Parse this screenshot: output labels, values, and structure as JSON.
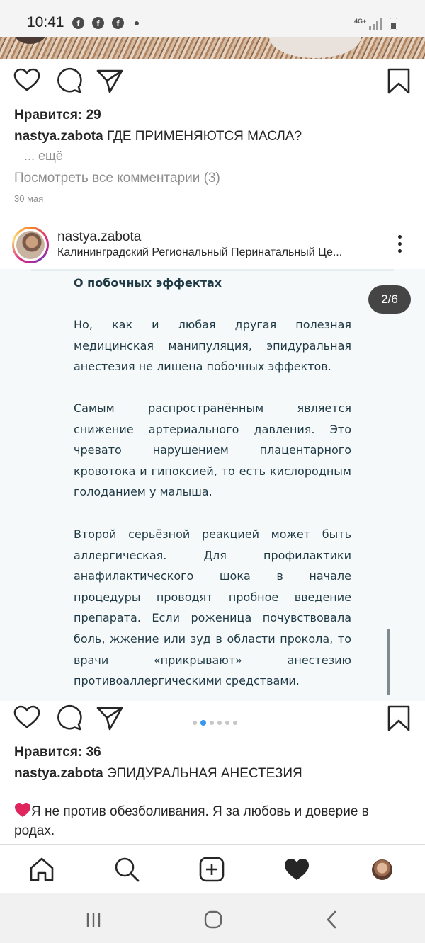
{
  "status_bar": {
    "time": "10:41",
    "notifications": [
      "facebook-icon",
      "facebook-icon",
      "facebook-icon"
    ],
    "network": "4G+"
  },
  "post1": {
    "likes": "Нравится: 29",
    "username": "nastya.zabota",
    "caption": "ГДЕ ПРИМЕНЯЮТСЯ МАСЛА?",
    "more": "... ещё",
    "view_comments": "Посмотреть все комментарии (3)",
    "date": "30 мая"
  },
  "post2": {
    "username": "nastya.zabota",
    "location": "Калининградский Региональный Перинатальный Це...",
    "slide": {
      "heading": "О побочных эффектах",
      "paragraphs": [
        "Но, как и любая другая полезная медицинская манипуляция, эпидуральная анестезия не лишена побочных эффектов.",
        "Самым распространённым является снижение артериального давления. Это чревато нарушением плацентарного кровотока и гипоксией, то есть кислородным голоданием у малыша.",
        "Второй серьёзной реакцией может быть аллергическая. Для профилактики анафилактического шока в начале процедуры проводят пробное введение препарата. Если роженица почувствовала боль, жжение или зуд в области прокола, то врачи «прикрывают» анестезию противоаллергическими средствами."
      ]
    },
    "page_indicator": "2/6",
    "carousel": {
      "total": 6,
      "active": 2
    },
    "likes": "Нравится: 36",
    "caption": "ЭПИДУРАЛЬНАЯ АНЕСТЕЗИЯ",
    "caption_body": "Я не против обезболивания. Я за любовь и доверие в родах."
  },
  "icons": {
    "like": "heart-outline-icon",
    "comment": "comment-bubble-icon",
    "share": "paper-plane-icon",
    "save": "bookmark-icon"
  },
  "bottom_nav": [
    "home-icon",
    "search-icon",
    "new-post-icon",
    "activity-heart-icon",
    "profile-avatar"
  ],
  "system_nav": [
    "recent-apps-icon",
    "home-button-icon",
    "back-icon"
  ],
  "colors": {
    "accent": "#3897f0",
    "emoji_heart": "#e0245e",
    "slide_bg": "#f6f9fa",
    "slide_text": "#1f3a44"
  }
}
